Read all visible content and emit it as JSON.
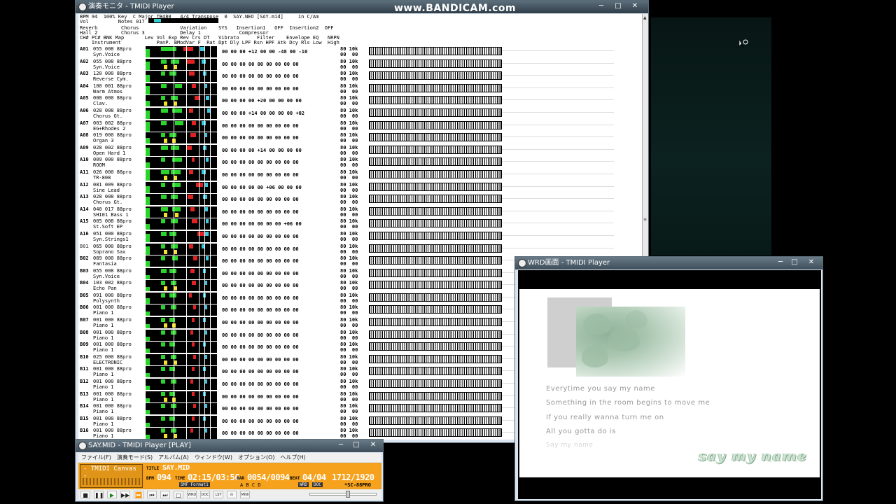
{
  "watermark": "www.BANDICAM.com",
  "monitor": {
    "title": "演奏モニタ - TMIDI Player",
    "hdr1": "BPM 94  100% Key  C Major TB480   4/4 Transpose  0  SAY.NEO [SAY.mid]     in C/Am",
    "hdr2": "Vol          Notes 017",
    "hdr3": "Reverb        Chorus              Variation    SYS   Insertion1   OFF  Insertion2  OFF",
    "hdr4": "Hall 2        Chorus 3            Delay 1             Compressor",
    "hdr5": "CH# PC# BNK Map       Lev Vol Exp Rev Crs DT   Vibrato      Filter    Envelope EQ   NRPN",
    "hdr6": "    Instrument            PanP. BModVar F  Rat Dpt Dly LPF Rsn HPF Atk Dcy Rls Low  High",
    "channels": [
      {
        "ch": "A01",
        "prog": "055 008 88pro",
        "inst": "Syn.Voice",
        "vals": "00 00 00 +12 00 00 -48 00 -10",
        "b1": "80",
        "b2": "00",
        "t1": "10k",
        "t2": "00"
      },
      {
        "ch": "A02",
        "prog": "055 008 88pro",
        "inst": "Syn.Voice",
        "vals": "00 00 00 00 00 00 00 00 00",
        "b1": "80",
        "b2": "00",
        "t1": "10k",
        "t2": "00"
      },
      {
        "ch": "A03",
        "prog": "120 000 88pro",
        "inst": "Reverse Cym.",
        "vals": "00 00 00 00 00 00 00 00 00",
        "b1": "80",
        "b2": "00",
        "t1": "10k",
        "t2": "00"
      },
      {
        "ch": "A04",
        "prog": "100 001 88pro",
        "inst": "Warm Atmos",
        "vals": "00 00 00 00 00 00 00 00 00",
        "b1": "80",
        "b2": "00",
        "t1": "10k",
        "t2": "00"
      },
      {
        "ch": "A05",
        "prog": "008 000 88pro",
        "inst": "Clav.",
        "vals": "00 00 00 00 +20 00 00 00 00",
        "b1": "80",
        "b2": "00",
        "t1": "10k",
        "t2": "00"
      },
      {
        "ch": "A06",
        "prog": "028 008 88pro",
        "inst": "Chorus Gt.",
        "vals": "00 00 00 +14 00 00 00 00 +02",
        "b1": "80",
        "b2": "00",
        "t1": "10k",
        "t2": "00"
      },
      {
        "ch": "A07",
        "prog": "003 002 88pro",
        "inst": "EG+Rhodes 2",
        "vals": "00 00 00 00 00 00 00 00 00",
        "b1": "80",
        "b2": "00",
        "t1": "10k",
        "t2": "00"
      },
      {
        "ch": "A08",
        "prog": "019 000 88pro",
        "inst": "Organ 3",
        "vals": "00 00 00 00 00 00 00 00 00",
        "b1": "80",
        "b2": "00",
        "t1": "10k",
        "t2": "00"
      },
      {
        "ch": "A09",
        "prog": "028 002 88pro",
        "inst": "Open Hard 1",
        "vals": "00 00 00 00 +14 00 00 00 00",
        "b1": "80",
        "b2": "00",
        "t1": "10k",
        "t2": "00"
      },
      {
        "ch": "A10",
        "prog": "009 000 88pro",
        "inst": "ROOM",
        "vals": "00 00 00 00 00 00 00 00 00",
        "b1": "80",
        "b2": "00",
        "t1": "10k",
        "t2": "00"
      },
      {
        "ch": "A11",
        "prog": "026 000 88pro",
        "inst": "TR-808",
        "vals": "00 00 00 00 00 00 00 00 00",
        "b1": "80",
        "b2": "00",
        "t1": "10k",
        "t2": "00"
      },
      {
        "ch": "A12",
        "prog": "081 009 88pro",
        "inst": "Sine Lead",
        "vals": "00 00 00 00 00 +06 00 00 00",
        "b1": "80",
        "b2": "00",
        "t1": "10k",
        "t2": "00"
      },
      {
        "ch": "A13",
        "prog": "028 008 88pro",
        "inst": "Chorus Gt.",
        "vals": "00 00 00 00 00 00 00 00 00",
        "b1": "80",
        "b2": "00",
        "t1": "10k",
        "t2": "00"
      },
      {
        "ch": "A14",
        "prog": "040 017 88pro",
        "inst": "SH101 Bass 1",
        "vals": "00 00 00 00 00 00 00 00 00",
        "b1": "80",
        "b2": "00",
        "t1": "10k",
        "t2": "00"
      },
      {
        "ch": "A15",
        "prog": "005 008 88pro",
        "inst": "St.Soft EP",
        "vals": "00 00 00 00 00 00 00 +06 00",
        "b1": "80",
        "b2": "00",
        "t1": "10k",
        "t2": "00"
      },
      {
        "ch": "A16",
        "prog": "051 000 88pro",
        "inst": "Syn.Strings1",
        "vals": "00 00 00 00 00 00 00 00 00",
        "b1": "80",
        "b2": "00",
        "t1": "10k",
        "t2": "00"
      },
      {
        "ch": "B01",
        "prog": "065 000 88pro",
        "inst": "Soprano Sax",
        "vals": "00 00 00 00 00 00 00 00 00",
        "b1": "80",
        "b2": "00",
        "t1": "10k",
        "t2": "00"
      },
      {
        "ch": "B02",
        "prog": "089 000 88pro",
        "inst": "Fantasia",
        "vals": "00 00 00 00 00 00 00 00 00",
        "b1": "80",
        "b2": "00",
        "t1": "10k",
        "t2": "00"
      },
      {
        "ch": "B03",
        "prog": "055 008 88pro",
        "inst": "Syn.Voice",
        "vals": "00 00 00 00 00 00 00 00 00",
        "b1": "80",
        "b2": "00",
        "t1": "10k",
        "t2": "00"
      },
      {
        "ch": "B04",
        "prog": "103 002 88pro",
        "inst": "Echo Pan",
        "vals": "00 00 00 00 00 00 00 00 00",
        "b1": "80",
        "b2": "00",
        "t1": "10k",
        "t2": "00"
      },
      {
        "ch": "B05",
        "prog": "091 000 88pro",
        "inst": "Polysynth",
        "vals": "00 00 00 00 00 00 00 00 00",
        "b1": "80",
        "b2": "00",
        "t1": "10k",
        "t2": "00"
      },
      {
        "ch": "B06",
        "prog": "001 000 88pro",
        "inst": "Piano 1",
        "vals": "00 00 00 00 00 00 00 00 00",
        "b1": "80",
        "b2": "00",
        "t1": "10k",
        "t2": "00"
      },
      {
        "ch": "B07",
        "prog": "001 000 88pro",
        "inst": "Piano 1",
        "vals": "00 00 00 00 00 00 00 00 00",
        "b1": "80",
        "b2": "00",
        "t1": "10k",
        "t2": "00"
      },
      {
        "ch": "B08",
        "prog": "001 000 88pro",
        "inst": "Piano 1",
        "vals": "00 00 00 00 00 00 00 00 00",
        "b1": "80",
        "b2": "00",
        "t1": "10k",
        "t2": "00"
      },
      {
        "ch": "B09",
        "prog": "001 000 88pro",
        "inst": "Piano 1",
        "vals": "00 00 00 00 00 00 00 00 00",
        "b1": "80",
        "b2": "00",
        "t1": "10k",
        "t2": "00"
      },
      {
        "ch": "B10",
        "prog": "025 000 88pro",
        "inst": "ELECTRONIC",
        "vals": "00 00 00 00 00 00 00 00 00",
        "b1": "80",
        "b2": "00",
        "t1": "10k",
        "t2": "00"
      },
      {
        "ch": "B11",
        "prog": "001 000 88pro",
        "inst": "Piano 1",
        "vals": "00 00 00 00 00 00 00 00 00",
        "b1": "80",
        "b2": "00",
        "t1": "10k",
        "t2": "00"
      },
      {
        "ch": "B12",
        "prog": "001 000 88pro",
        "inst": "Piano 1",
        "vals": "00 00 00 00 00 00 00 00 00",
        "b1": "80",
        "b2": "00",
        "t1": "10k",
        "t2": "00"
      },
      {
        "ch": "B13",
        "prog": "001 000 88pro",
        "inst": "Piano 1",
        "vals": "00 00 00 00 00 00 00 00 00",
        "b1": "80",
        "b2": "00",
        "t1": "10k",
        "t2": "00"
      },
      {
        "ch": "B14",
        "prog": "001 000 88pro",
        "inst": "Piano 1",
        "vals": "00 00 00 00 00 00 00 00 00",
        "b1": "80",
        "b2": "00",
        "t1": "10k",
        "t2": "00"
      },
      {
        "ch": "B15",
        "prog": "001 000 88pro",
        "inst": "Piano 1",
        "vals": "00 00 00 00 00 00 00 00 00",
        "b1": "80",
        "b2": "00",
        "t1": "10k",
        "t2": "00"
      },
      {
        "ch": "B16",
        "prog": "001 000 88pro",
        "inst": "Piano 1",
        "vals": "00 00 00 00 00 00 00 00 00",
        "b1": "80",
        "b2": "00",
        "t1": "10k",
        "t2": "00"
      }
    ]
  },
  "wrd": {
    "title": "WRD画面 - TMIDI Player",
    "lyrics": [
      "Everytime you say my name",
      "Something in the room begins to move me",
      "If you really wanna turn me on",
      "All you gotta do is",
      "Say my name"
    ],
    "big_title": "say my name"
  },
  "player": {
    "title": "SAY.MID - TMIDI Player [PLAY]",
    "menus": [
      "ファイル(F)",
      "演奏モード(S)",
      "アルバム(A)",
      "ウィンドウ(W)",
      "オプション(O)",
      "ヘルプ(H)"
    ],
    "canvas_label": "- TMIDI Canvas -",
    "title_label": "TITLE",
    "title_value": "SAY.MID",
    "bpm_label": "BPM",
    "bpm": "094",
    "time_label": "TIME",
    "time": "02:15/03:56",
    "bar_label": "BAR",
    "bar": "0054/0094",
    "beat_label": "BEAT",
    "beat": "04/04",
    "tick": "1712/1920",
    "smf_format": "SMF Format1",
    "abcd": "A B C D",
    "wrd_tag": "WRD",
    "doc_tag": "DOC",
    "module": "*SC-88PRO",
    "seek_fraction": 0.57,
    "toolbar_buttons": [
      "■",
      "❚❚",
      "▶",
      "▶▶",
      "⏩",
      "⏮",
      "⏭",
      "□",
      "WRD",
      "DOC",
      "LST",
      "ılı",
      "MINI"
    ]
  },
  "window_controls": {
    "min": "─",
    "max": "□",
    "close": "✕"
  }
}
